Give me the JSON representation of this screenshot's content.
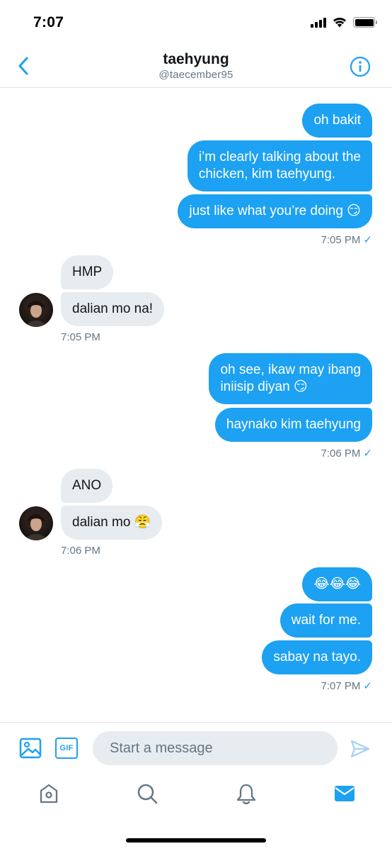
{
  "status_bar": {
    "time": "7:07"
  },
  "header": {
    "name": "taehyung",
    "handle": "@taecember95",
    "back_icon": "chevron-left-icon",
    "info_icon": "info-circle-icon"
  },
  "messages": [
    {
      "dir": "out",
      "text": "oh bakit"
    },
    {
      "dir": "out",
      "lines": [
        "i’m clearly talking about the",
        "chicken, kim taehyung."
      ]
    },
    {
      "dir": "out",
      "text": "just like what you’re doing 😏"
    },
    {
      "dir": "in",
      "text": "HMP"
    },
    {
      "dir": "in",
      "text": "dalian mo na!"
    },
    {
      "dir": "out",
      "lines": [
        "oh see, ikaw may ibang",
        "iniisip diyan 😏"
      ]
    },
    {
      "dir": "out",
      "text": "haynako kim taehyung"
    },
    {
      "dir": "in",
      "text": "ANO"
    },
    {
      "dir": "in",
      "text": "dalian mo 😤"
    },
    {
      "dir": "out",
      "text": "😂😂😂"
    },
    {
      "dir": "out",
      "text": "wait for me."
    },
    {
      "dir": "out",
      "text": "sabay na tayo."
    }
  ],
  "timestamps": [
    "7:05 PM",
    "7:05 PM",
    "7:06 PM",
    "7:06 PM",
    "7:07 PM"
  ],
  "read_check": "✓",
  "composer": {
    "gif_label": "GIF",
    "placeholder": "Start a message",
    "media_icon": "image-icon",
    "send_icon": "send-icon"
  },
  "tab_bar": {
    "items": [
      "home-icon",
      "search-icon",
      "notifications-bell-icon",
      "messages-envelope-icon"
    ],
    "active": "messages-envelope-icon"
  },
  "colors": {
    "accent": "#1da1f2",
    "incoming_bubble": "#e6ecf0",
    "secondary_text": "#657786",
    "divider": "#dfe3e7"
  }
}
